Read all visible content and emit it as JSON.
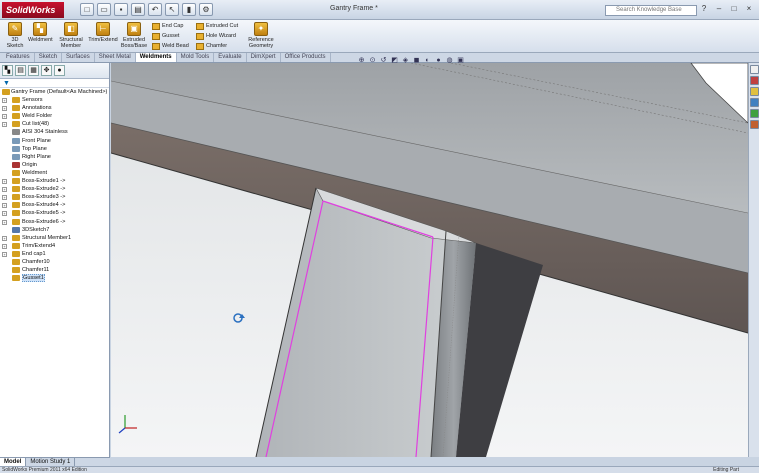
{
  "app": {
    "logo": "SolidWorks",
    "doc_title": "Gantry Frame *",
    "search_placeholder": "Search Knowledge Base"
  },
  "quick_access": [
    "new-icon",
    "open-icon",
    "save-icon",
    "print-icon",
    "undo-icon",
    "select-icon",
    "rebuild-icon",
    "options-icon"
  ],
  "window_buttons": [
    "?",
    "–",
    "□",
    "×"
  ],
  "command_buttons": {
    "sketch": "3D Sketch",
    "weldment": "Weldment",
    "structural_member": "Structural Member",
    "trim_extend": "Trim/Extend",
    "extruded_boss": "Extruded Boss/Base",
    "end_cap": "End Cap",
    "gusset": "Gusset",
    "weld_bead": "Weld Bead",
    "extruded_cut": "Extruded Cut",
    "hole_wizard": "Hole Wizard",
    "chamfer": "Chamfer",
    "reference_geometry": "Reference Geometry"
  },
  "tabs": [
    "Features",
    "Sketch",
    "Surfaces",
    "Sheet Metal",
    "Weldments",
    "Mold Tools",
    "Evaluate",
    "DimXpert",
    "Office Products"
  ],
  "active_tab": "Weldments",
  "feature_tree": {
    "root": "Gantry Frame  (Default<As Machined>)",
    "items": [
      {
        "label": "Sensors",
        "color": "#d4a020",
        "expandable": true
      },
      {
        "label": "Annotations",
        "color": "#d4a020",
        "expandable": true
      },
      {
        "label": "Weld Folder",
        "color": "#d4a020",
        "expandable": true
      },
      {
        "label": "Cut list(48)",
        "color": "#d4a020",
        "expandable": true
      },
      {
        "label": "AISI 304 Stainless",
        "color": "#888888",
        "expandable": false
      },
      {
        "label": "Front Plane",
        "color": "#7a9ab8",
        "expandable": false
      },
      {
        "label": "Top Plane",
        "color": "#7a9ab8",
        "expandable": false
      },
      {
        "label": "Right Plane",
        "color": "#7a9ab8",
        "expandable": false
      },
      {
        "label": "Origin",
        "color": "#aa3333",
        "expandable": false
      },
      {
        "label": "Weldment",
        "color": "#d4a020",
        "expandable": false
      },
      {
        "label": "Boss-Extrude1 ->",
        "color": "#d4a020",
        "expandable": true
      },
      {
        "label": "Boss-Extrude2 ->",
        "color": "#d4a020",
        "expandable": true
      },
      {
        "label": "Boss-Extrude3 ->",
        "color": "#d4a020",
        "expandable": true
      },
      {
        "label": "Boss-Extrude4 ->",
        "color": "#d4a020",
        "expandable": true
      },
      {
        "label": "Boss-Extrude5 ->",
        "color": "#d4a020",
        "expandable": true
      },
      {
        "label": "Boss-Extrude6 ->",
        "color": "#d4a020",
        "expandable": true
      },
      {
        "label": "3DSketch7",
        "color": "#5577aa",
        "expandable": false
      },
      {
        "label": "Structural Member1",
        "color": "#d4a020",
        "expandable": true
      },
      {
        "label": "Trim/Extend4",
        "color": "#d4a020",
        "expandable": true
      },
      {
        "label": "End cap1",
        "color": "#d4a020",
        "expandable": true
      },
      {
        "label": "Chamfer10",
        "color": "#d4a020",
        "expandable": false
      },
      {
        "label": "Chamfer11",
        "color": "#d4a020",
        "expandable": false
      },
      {
        "label": "Gusset1",
        "color": "#d4a020",
        "expandable": false,
        "selected": true
      }
    ]
  },
  "bottom_tabs": [
    "Model",
    "Motion Study 1"
  ],
  "status": {
    "left": "SolidWorks Premium 2011 x64 Edition",
    "right": "Editing Part"
  },
  "colors": {
    "accent": "#c8102e",
    "edge_highlight": "#e040e0"
  }
}
